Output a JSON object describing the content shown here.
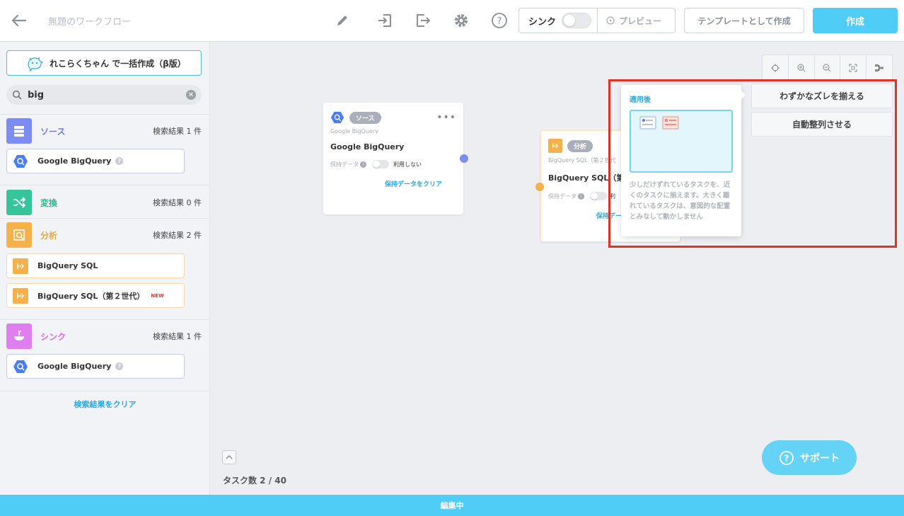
{
  "header": {
    "title": "無題のワークフロー",
    "sync_label": "シンク",
    "preview_label": "プレビュー",
    "template_label": "テンプレートとして作成",
    "create_label": "作成"
  },
  "sidebar": {
    "ai_button": "れこらくちゃん で一括作成（β版）",
    "search_value": "big",
    "sections": {
      "source": {
        "name": "ソース",
        "count": "検索結果 1 件",
        "color": "#7c8cf0",
        "items": [
          {
            "label": "Google BigQuery"
          }
        ]
      },
      "transform": {
        "name": "変換",
        "count": "検索結果 0 件",
        "color": "#36c49a"
      },
      "analysis": {
        "name": "分析",
        "count": "検索結果 2 件",
        "color": "#f6b14b",
        "items": [
          {
            "label": "BigQuery SQL"
          },
          {
            "label": "BigQuery SQL（第２世代）",
            "badge": "NEW"
          }
        ]
      },
      "sink": {
        "name": "シンク",
        "count": "検索結果 1 件",
        "color": "#e07ef0",
        "items": [
          {
            "label": "Google BigQuery"
          }
        ]
      }
    },
    "clear_label": "検索結果をクリア"
  },
  "canvas": {
    "node1": {
      "pill": "ソース",
      "sub": "Google BigQuery",
      "title": "Google BigQuery",
      "retain_label": "保持データ",
      "toggle_label": "利用しない",
      "link": "保持データをクリア"
    },
    "node2": {
      "pill": "分析",
      "sub": "BigQuery SQL（第２世代",
      "title": "BigQuery SQL（第２",
      "retain_label": "保持データ",
      "toggle_label": "利",
      "link": "保持デー"
    },
    "popup": {
      "title": "適用後",
      "description": "少しだけずれているタスクを、近くのタスクに揃えます。大きく離れているタスクは、意図的な配置とみなして動かしません"
    },
    "menu": {
      "align_label": "わずかなズレを揃える",
      "auto_label": "自動整列させる"
    },
    "task_count": "タスク数 2 / 40",
    "support_label": "サポート"
  },
  "status_bar": {
    "label": "編集中"
  },
  "colors": {
    "accent": "#50cdf6",
    "highlight": "#e03423",
    "link": "#2ea8de"
  },
  "icons": [
    "back-arrow-icon",
    "pencil-icon",
    "import-icon",
    "export-icon",
    "gear-icon",
    "help-icon",
    "play-circle-icon",
    "mascot-icon",
    "search-icon",
    "clear-icon",
    "database-icon",
    "shuffle-icon",
    "analysis-chart-icon",
    "sink-icon",
    "bigquery-icon",
    "sql-icon",
    "target-icon",
    "zoom-in-icon",
    "zoom-out-icon",
    "fit-icon",
    "arrange-icon",
    "chevron-up-icon",
    "question-icon"
  ]
}
